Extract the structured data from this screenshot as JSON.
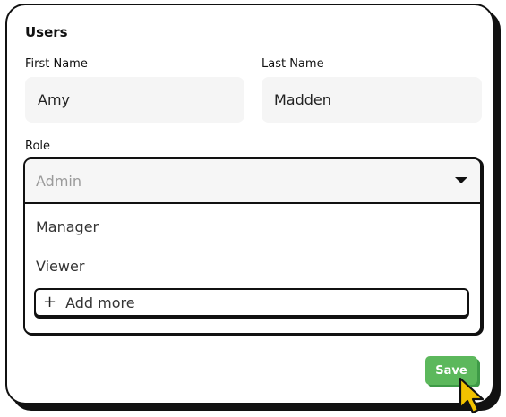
{
  "form": {
    "title": "Users",
    "first_name": {
      "label": "First Name",
      "value": "Amy"
    },
    "last_name": {
      "label": "Last Name",
      "value": "Madden"
    },
    "role": {
      "label": "Role",
      "placeholder": "Admin",
      "options": [
        "Manager",
        "Viewer"
      ],
      "add_more_label": "Add more"
    },
    "save_label": "Save"
  },
  "colors": {
    "save_button": "#5cb85c",
    "cursor": "#f2c200"
  }
}
